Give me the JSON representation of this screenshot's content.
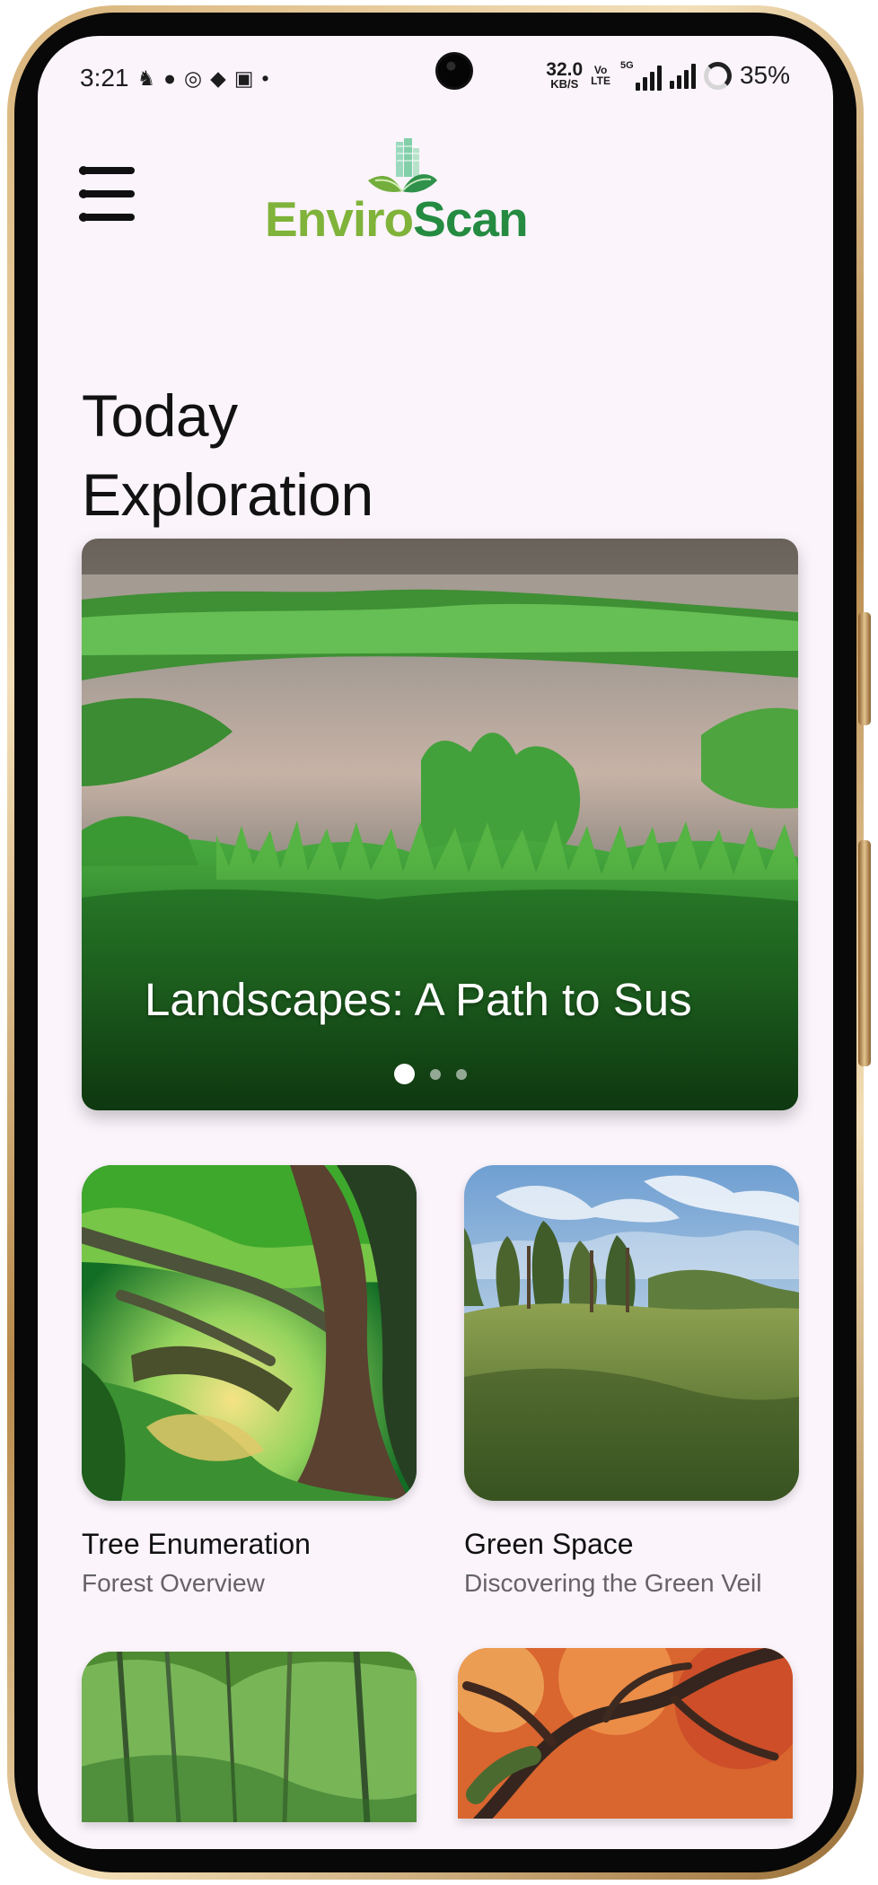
{
  "status_bar": {
    "time": "3:21",
    "network_speed": "32.0",
    "network_unit": "KB/S",
    "volte_top": "Vo",
    "volte_bottom": "LTE",
    "network_type": "5G",
    "battery": "35%"
  },
  "header": {
    "logo_left": "Enviro",
    "logo_right": "Scan",
    "logo_colors": {
      "green_light": "#7fb33a",
      "green_dark": "#248b41"
    }
  },
  "main": {
    "title_line_1": "Today",
    "title_line_2": "Exploration"
  },
  "carousel": {
    "title": "Landscapes: A Path to Sus",
    "active_dot": 1,
    "dot_count": 3
  },
  "cards": [
    {
      "title": "Tree Enumeration",
      "subtitle": "Forest Overview"
    },
    {
      "title": "Green Space",
      "subtitle": "Discovering the Green Veil"
    },
    {
      "title": "",
      "subtitle": ""
    },
    {
      "title": "",
      "subtitle": ""
    }
  ]
}
